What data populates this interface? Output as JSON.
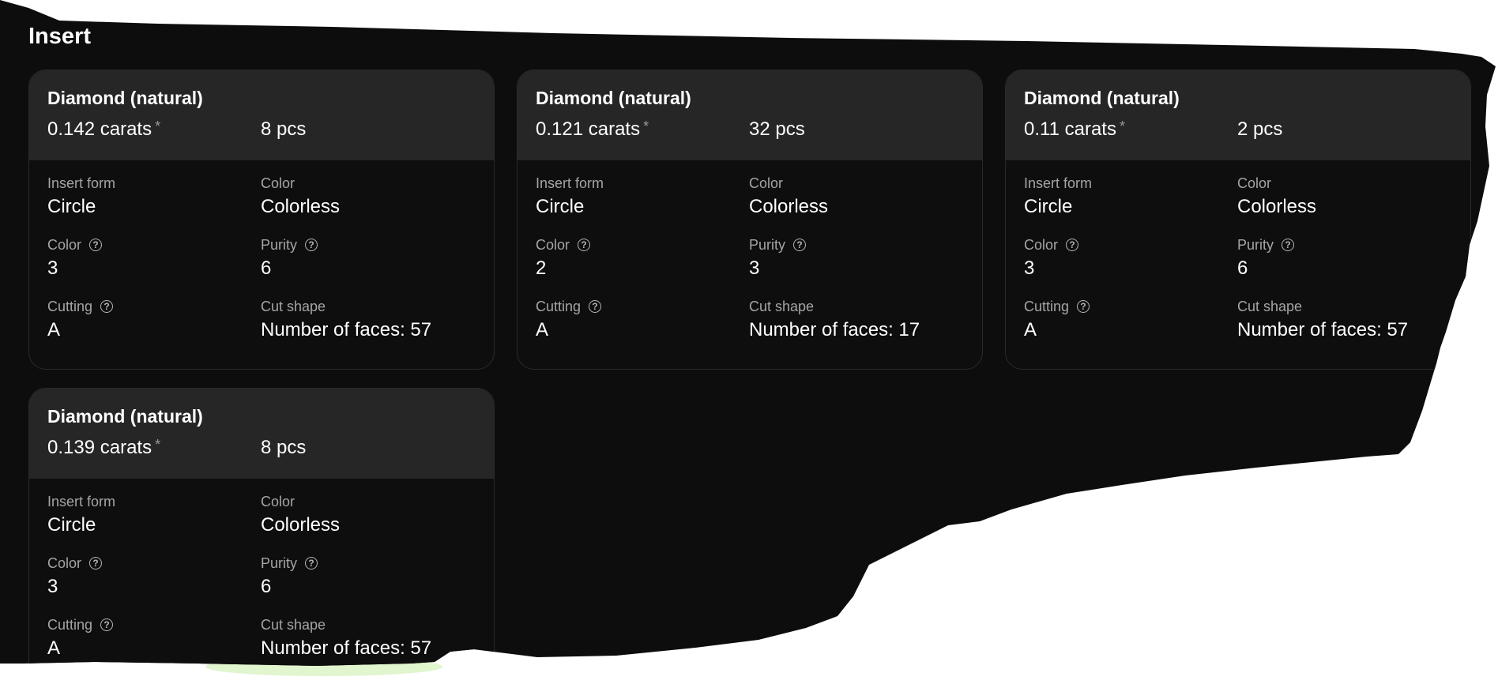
{
  "section": {
    "title": "Insert"
  },
  "labels": {
    "insert_form": "Insert form",
    "color": "Color",
    "color_grade": "Color",
    "purity": "Purity",
    "cutting": "Cutting",
    "cut_shape": "Cut shape"
  },
  "help_glyph": "?",
  "icons": {
    "help": "question-circle-icon"
  },
  "colors": {
    "panel": "#0d0d0d",
    "card_header": "#262626",
    "label": "#a5a5a5"
  },
  "cards": [
    {
      "title": "Diamond (natural)",
      "carats": "0.142 carats",
      "star": "*",
      "qty": "8 pcs",
      "insert_form": "Circle",
      "color": "Colorless",
      "color_grade": "3",
      "purity": "6",
      "cutting": "A",
      "cut_shape": "Number of faces: 57"
    },
    {
      "title": "Diamond (natural)",
      "carats": "0.121 carats",
      "star": "*",
      "qty": "32 pcs",
      "insert_form": "Circle",
      "color": "Colorless",
      "color_grade": "2",
      "purity": "3",
      "cutting": "A",
      "cut_shape": "Number of faces: 17"
    },
    {
      "title": "Diamond (natural)",
      "carats": "0.11 carats",
      "star": "*",
      "qty": "2 pcs",
      "insert_form": "Circle",
      "color": "Colorless",
      "color_grade": "3",
      "purity": "6",
      "cutting": "A",
      "cut_shape": "Number of faces: 57"
    },
    {
      "title": "Diamond (natural)",
      "carats": "0.139 carats",
      "star": "*",
      "qty": "8 pcs",
      "insert_form": "Circle",
      "color": "Colorless",
      "color_grade": "3",
      "purity": "6",
      "cutting": "A",
      "cut_shape": "Number of faces: 57"
    }
  ]
}
